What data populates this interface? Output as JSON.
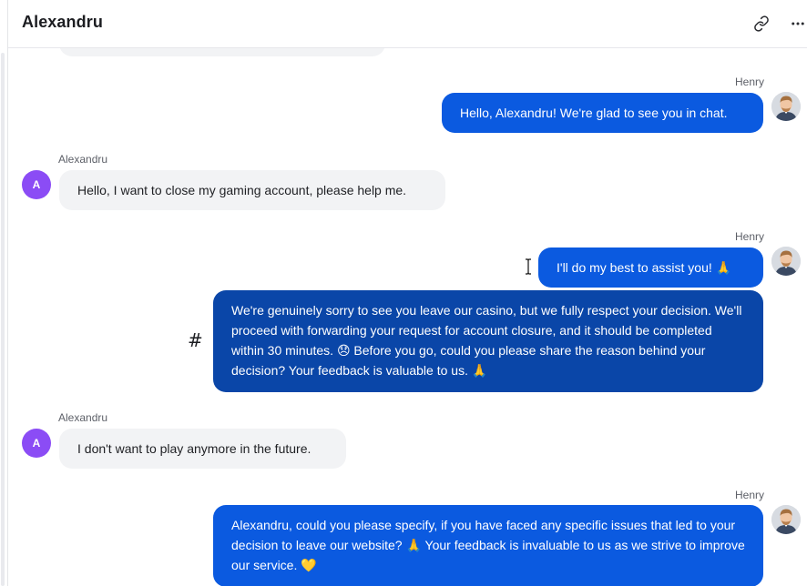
{
  "header": {
    "title": "Alexandru",
    "link_icon": "link-icon",
    "more_icon": "more-horizontal-icon"
  },
  "colors": {
    "outgoing_bubble": "#0b5ae0",
    "outgoing_bubble_selected": "#0a46a8",
    "incoming_bubble": "#f2f3f5",
    "avatar_letter_bg": "#8b4cf5"
  },
  "messages": [
    {
      "direction": "out",
      "sender": "Henry",
      "text": "Hello, Alexandru! We're glad to see you in chat."
    },
    {
      "direction": "in",
      "sender": "Alexandru",
      "avatar": "A",
      "text": "Hello, I want to close my gaming account, please help me."
    },
    {
      "direction": "out",
      "sender": "Henry",
      "text": "I'll do my best to assist you! 🙏"
    },
    {
      "direction": "out",
      "sender": "Henry",
      "marker": "#",
      "text": "We're genuinely sorry to see you leave our casino, but we fully respect your decision. We'll proceed with forwarding your request for account closure, and it should be completed within 30 minutes. 😞 Before you go, could you please share the reason behind your decision? Your feedback is valuable to us. 🙏"
    },
    {
      "direction": "in",
      "sender": "Alexandru",
      "avatar": "A",
      "text": "I don't want to play anymore in the future."
    },
    {
      "direction": "out",
      "sender": "Henry",
      "text": "Alexandru, could you please specify, if you have faced any specific issues that led to your decision to leave our website? 🙏 Your feedback is invaluable to us as we strive to improve our service. 💛"
    }
  ]
}
